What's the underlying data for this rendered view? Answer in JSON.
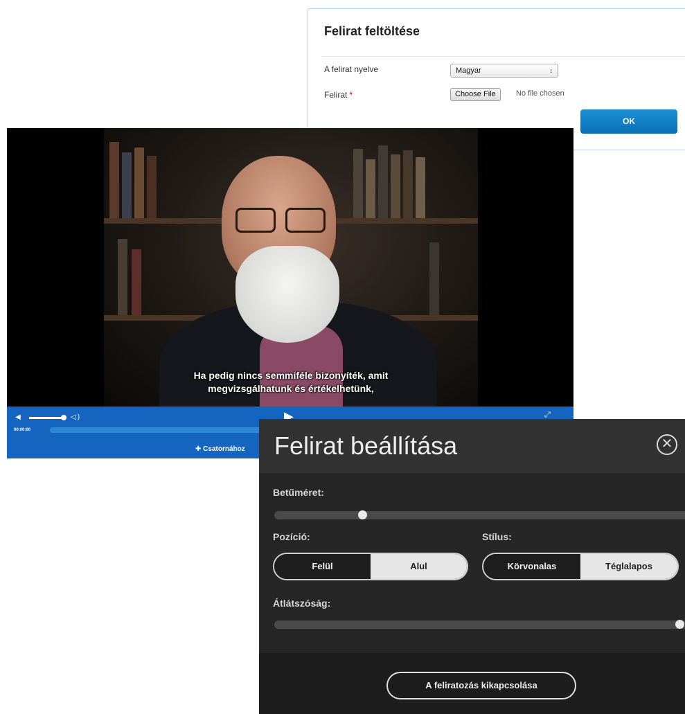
{
  "upload": {
    "title": "Felirat feltöltése",
    "language_label": "A felirat nyelve",
    "language_value": "Magyar",
    "file_label": "Felirat",
    "required_mark": "*",
    "choose_file_label": "Choose File",
    "no_file_text": "No file chosen",
    "ok_label": "OK"
  },
  "player": {
    "subtitle_line1": "Ha pedig nincs semmiféle bizonyíték, amit",
    "subtitle_line2": "megvizsgálhatunk és értékelhetünk,",
    "time": "00:00:00",
    "add_label": "Csatornához",
    "volume_level": 0.8
  },
  "settings": {
    "title": "Felirat beállítása",
    "font_size_label": "Betűméret:",
    "font_size_value": 0.2,
    "position_label": "Pozíció:",
    "position_options": [
      "Felül",
      "Alul"
    ],
    "position_selected": "Felül",
    "style_label": "Stílus:",
    "style_options": [
      "Körvonalas",
      "Téglalapos"
    ],
    "style_selected": "Körvonalas",
    "opacity_label": "Átlátszóság:",
    "opacity_value": 1.0,
    "disable_label": "A feliratozás kikapcsolása"
  },
  "colors": {
    "accent": "#1565c0",
    "ok_button": "#0a6fb7",
    "dialog_bg": "#262626"
  },
  "icons": [
    "volume-icon",
    "play-icon",
    "fullscreen-icon",
    "plus-icon",
    "close-icon",
    "select-arrows-icon"
  ]
}
